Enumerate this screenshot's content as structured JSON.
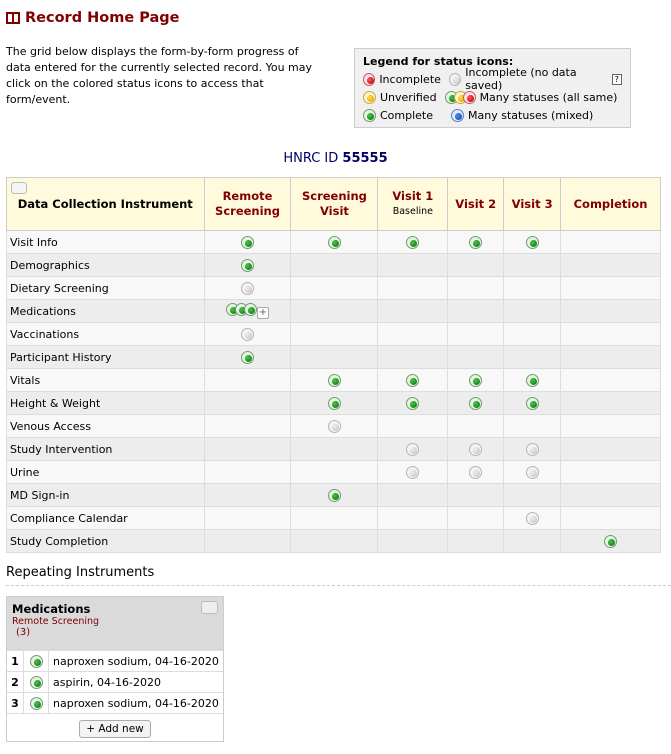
{
  "page_title": "Record Home Page",
  "intro": "The grid below displays the form-by-form progress of data entered for the currently selected record. You may click on the colored status icons to access that form/event.",
  "legend": {
    "title": "Legend for status icons:",
    "incomplete": "Incomplete",
    "incomplete_no_data": "Incomplete (no data saved)",
    "help": "?",
    "unverified": "Unverified",
    "many_same": "Many statuses (all same)",
    "complete": "Complete",
    "many_mixed": "Many statuses (mixed)"
  },
  "record": {
    "label": "HNRC ID",
    "id": "55555"
  },
  "grid": {
    "instrument_header": "Data Collection Instrument",
    "events": [
      {
        "name": "Remote Screening",
        "sub": ""
      },
      {
        "name": "Screening Visit",
        "sub": ""
      },
      {
        "name": "Visit 1",
        "sub": "Baseline"
      },
      {
        "name": "Visit 2",
        "sub": ""
      },
      {
        "name": "Visit 3",
        "sub": ""
      },
      {
        "name": "Completion",
        "sub": ""
      }
    ],
    "rows": [
      {
        "name": "Visit Info",
        "status": [
          "green",
          "green",
          "green",
          "green",
          "green",
          ""
        ]
      },
      {
        "name": "Demographics",
        "status": [
          "green",
          "",
          "",
          "",
          "",
          ""
        ]
      },
      {
        "name": "Dietary Screening",
        "status": [
          "gray",
          "",
          "",
          "",
          "",
          ""
        ]
      },
      {
        "name": "Medications",
        "status": [
          "green-stack",
          "",
          "",
          "",
          "",
          ""
        ]
      },
      {
        "name": "Vaccinations",
        "status": [
          "gray",
          "",
          "",
          "",
          "",
          ""
        ]
      },
      {
        "name": "Participant History",
        "status": [
          "green",
          "",
          "",
          "",
          "",
          ""
        ]
      },
      {
        "name": "Vitals",
        "status": [
          "",
          "green",
          "green",
          "green",
          "green",
          ""
        ]
      },
      {
        "name": "Height & Weight",
        "status": [
          "",
          "green",
          "green",
          "green",
          "green",
          ""
        ]
      },
      {
        "name": "Venous Access",
        "status": [
          "",
          "gray",
          "",
          "",
          "",
          ""
        ]
      },
      {
        "name": "Study Intervention",
        "status": [
          "",
          "",
          "gray",
          "gray",
          "gray",
          ""
        ]
      },
      {
        "name": "Urine",
        "status": [
          "",
          "",
          "gray",
          "gray",
          "gray",
          ""
        ]
      },
      {
        "name": "MD Sign-in",
        "status": [
          "",
          "green",
          "",
          "",
          "",
          ""
        ]
      },
      {
        "name": "Compliance Calendar",
        "status": [
          "",
          "",
          "",
          "",
          "gray",
          ""
        ]
      },
      {
        "name": "Study Completion",
        "status": [
          "",
          "",
          "",
          "",
          "",
          "green"
        ]
      }
    ]
  },
  "repeating": {
    "title": "Repeating Instruments",
    "instrument": "Medications",
    "event": "Remote Screening",
    "count": "(3)",
    "items": [
      {
        "num": "1",
        "label": "naproxen sodium, 04-16-2020"
      },
      {
        "num": "2",
        "label": "aspirin, 04-16-2020"
      },
      {
        "num": "3",
        "label": "naproxen sodium, 04-16-2020"
      }
    ],
    "add_label": "+ Add new"
  }
}
